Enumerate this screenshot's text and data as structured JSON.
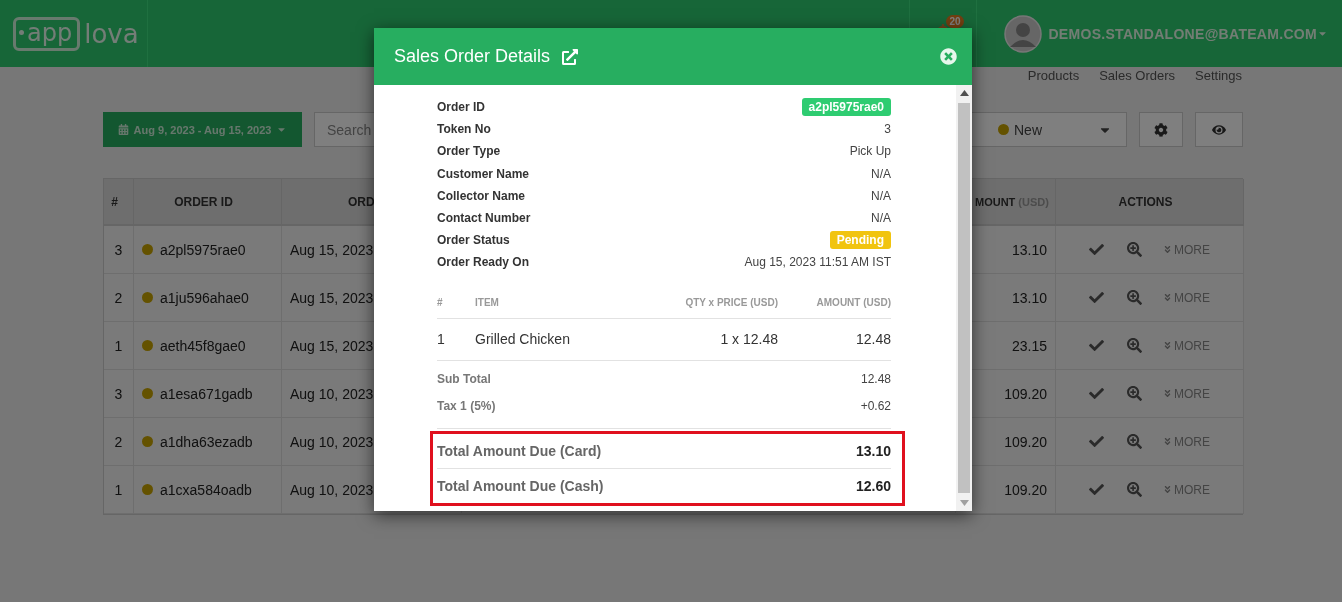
{
  "header": {
    "logo": {
      "boxed": "app",
      "plain": "lova"
    },
    "notifications": "20",
    "user": "DEMOS.STANDALONE@BATEAM.COM"
  },
  "nav": [
    "Products",
    "Sales Orders",
    "Settings"
  ],
  "toolbar": {
    "date_range": "Aug 9, 2023 - Aug 15, 2023",
    "search": {
      "placeholder": "Search"
    },
    "status_filter": {
      "value": "New"
    }
  },
  "table": {
    "columns": [
      "#",
      "ORDER ID",
      "ORD",
      {
        "label": "MOUNT",
        "unit": "(USD)"
      },
      "ACTIONS"
    ],
    "rows": [
      {
        "number": "3",
        "order_id": "a2pl5975rae0",
        "date": "Aug 15, 2023",
        "amount": "13.10",
        "more": "MORE"
      },
      {
        "number": "2",
        "order_id": "a1ju596ahae0",
        "date": "Aug 15, 2023",
        "amount": "13.10",
        "more": "MORE"
      },
      {
        "number": "1",
        "order_id": "aeth45f8gae0",
        "date": "Aug 15, 2023",
        "amount": "23.15",
        "more": "MORE"
      },
      {
        "number": "3",
        "order_id": "a1esa671gadb",
        "date": "Aug 10, 2023",
        "amount": "109.20",
        "more": "MORE"
      },
      {
        "number": "2",
        "order_id": "a1dha63ezadb",
        "date": "Aug 10, 2023",
        "amount": "109.20",
        "more": "MORE"
      },
      {
        "number": "1",
        "order_id": "a1cxa584oadb",
        "date": "Aug 10, 2023",
        "amount": "109.20",
        "more": "MORE"
      }
    ]
  },
  "modal": {
    "title": "Sales Order Details",
    "details": [
      {
        "label": "Order ID",
        "value": "a2pl5975rae0",
        "kind": "badge",
        "color": "#2ecc71"
      },
      {
        "label": "Token No",
        "value": "3",
        "kind": "text"
      },
      {
        "label": "Order Type",
        "value": "Pick Up",
        "kind": "text"
      },
      {
        "label": "Customer Name",
        "value": "N/A",
        "kind": "text"
      },
      {
        "label": "Collector Name",
        "value": "N/A",
        "kind": "text"
      },
      {
        "label": "Contact Number",
        "value": "N/A",
        "kind": "text"
      },
      {
        "label": "Order Status",
        "value": "Pending",
        "kind": "badge",
        "color": "#f1c40f"
      },
      {
        "label": "Order Ready On",
        "value": "Aug 15, 2023 11:51 AM IST",
        "kind": "text"
      }
    ],
    "items": {
      "columns": [
        "#",
        "ITEM",
        "QTY x PRICE (USD)",
        "AMOUNT (USD)"
      ],
      "rows": [
        {
          "number": "1",
          "item": "Grilled Chicken",
          "qty_price": "1 x 12.48",
          "amount": "12.48"
        }
      ]
    },
    "summary": [
      {
        "label": "Sub Total",
        "value": "12.48"
      },
      {
        "label": "Tax 1 (5%)",
        "value": "+0.62"
      }
    ],
    "totals": [
      {
        "label": "Total Amount Due (Card)",
        "value": "13.10"
      },
      {
        "label": "Total Amount Due (Cash)",
        "value": "12.60"
      }
    ]
  }
}
